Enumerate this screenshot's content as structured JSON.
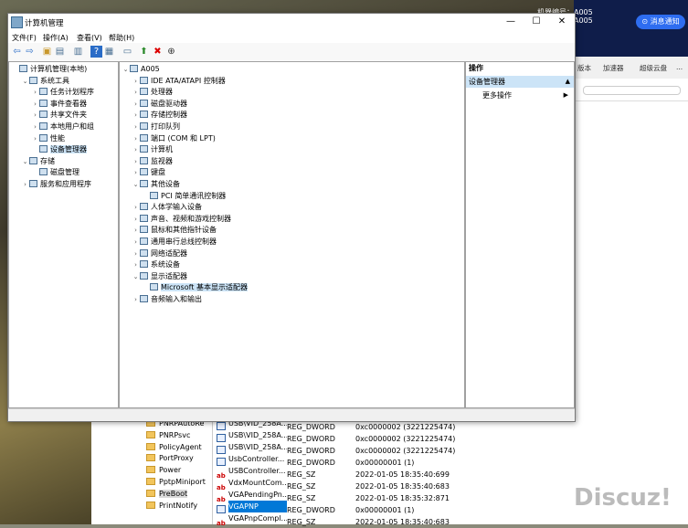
{
  "window": {
    "title": "计算机管理",
    "menu": [
      "文件(F)",
      "操作(A)",
      "查看(V)",
      "帮助(H)"
    ],
    "min": "—",
    "max": "☐",
    "close": "✕"
  },
  "left_tree": [
    {
      "label": "计算机管理(本地)",
      "arrow": "",
      "indent": 0,
      "sel": false
    },
    {
      "label": "系统工具",
      "arrow": "⌄",
      "indent": 1,
      "sel": false
    },
    {
      "label": "任务计划程序",
      "arrow": "›",
      "indent": 2,
      "sel": false
    },
    {
      "label": "事件查看器",
      "arrow": "›",
      "indent": 2,
      "sel": false
    },
    {
      "label": "共享文件夹",
      "arrow": "›",
      "indent": 2,
      "sel": false
    },
    {
      "label": "本地用户和组",
      "arrow": "›",
      "indent": 2,
      "sel": false
    },
    {
      "label": "性能",
      "arrow": "›",
      "indent": 2,
      "sel": false
    },
    {
      "label": "设备管理器",
      "arrow": "",
      "indent": 2,
      "sel": true
    },
    {
      "label": "存储",
      "arrow": "⌄",
      "indent": 1,
      "sel": false
    },
    {
      "label": "磁盘管理",
      "arrow": "",
      "indent": 2,
      "sel": false
    },
    {
      "label": "服务和应用程序",
      "arrow": "›",
      "indent": 1,
      "sel": false
    }
  ],
  "device_tree": [
    {
      "label": "A005",
      "arrow": "⌄",
      "indent": 0,
      "sel": false
    },
    {
      "label": "IDE ATA/ATAPI 控制器",
      "arrow": "›",
      "indent": 1,
      "sel": false
    },
    {
      "label": "处理器",
      "arrow": "›",
      "indent": 1,
      "sel": false
    },
    {
      "label": "磁盘驱动器",
      "arrow": "›",
      "indent": 1,
      "sel": false
    },
    {
      "label": "存储控制器",
      "arrow": "›",
      "indent": 1,
      "sel": false
    },
    {
      "label": "打印队列",
      "arrow": "›",
      "indent": 1,
      "sel": false
    },
    {
      "label": "端口 (COM 和 LPT)",
      "arrow": "›",
      "indent": 1,
      "sel": false
    },
    {
      "label": "计算机",
      "arrow": "›",
      "indent": 1,
      "sel": false
    },
    {
      "label": "监视器",
      "arrow": "›",
      "indent": 1,
      "sel": false
    },
    {
      "label": "键盘",
      "arrow": "›",
      "indent": 1,
      "sel": false
    },
    {
      "label": "其他设备",
      "arrow": "⌄",
      "indent": 1,
      "sel": false
    },
    {
      "label": "PCI 简单通讯控制器",
      "arrow": "",
      "indent": 2,
      "sel": false
    },
    {
      "label": "人体学输入设备",
      "arrow": "›",
      "indent": 1,
      "sel": false
    },
    {
      "label": "声音、视频和游戏控制器",
      "arrow": "›",
      "indent": 1,
      "sel": false
    },
    {
      "label": "鼠标和其他指针设备",
      "arrow": "›",
      "indent": 1,
      "sel": false
    },
    {
      "label": "通用串行总线控制器",
      "arrow": "›",
      "indent": 1,
      "sel": false
    },
    {
      "label": "网络适配器",
      "arrow": "›",
      "indent": 1,
      "sel": false
    },
    {
      "label": "系统设备",
      "arrow": "›",
      "indent": 1,
      "sel": false
    },
    {
      "label": "显示适配器",
      "arrow": "⌄",
      "indent": 1,
      "sel": false
    },
    {
      "label": "Microsoft 基本显示适配器",
      "arrow": "",
      "indent": 2,
      "sel": true
    },
    {
      "label": "音频输入和输出",
      "arrow": "›",
      "indent": 1,
      "sel": false
    }
  ],
  "actions": {
    "header": "操作",
    "selected": "设备管理器",
    "more": "更多操作"
  },
  "site": {
    "user_label": "机器编号：A005",
    "user_sub": "A005",
    "msg_button": "消息通知",
    "nav": [
      "版本",
      "加速器",
      "超级云盘",
      "..."
    ],
    "watermark": "Discuz!"
  },
  "registry": {
    "keys": [
      "PNRPAutoRe",
      "PNRPsvc",
      "PolicyAgent",
      "PortProxy",
      "Power",
      "PptpMiniport",
      "PreBoot",
      "PrintNotify"
    ],
    "selected_key": "PreBoot",
    "values": [
      {
        "name": "USB\\VID_258A...",
        "type": "REG_DWORD",
        "data": "0xc0000002 (3221225474)",
        "kind": "dword"
      },
      {
        "name": "USB\\VID_258A...",
        "type": "REG_DWORD",
        "data": "0xc0000002 (3221225474)",
        "kind": "dword"
      },
      {
        "name": "USB\\VID_258A...",
        "type": "REG_DWORD",
        "data": "0xc0000002 (3221225474)",
        "kind": "dword"
      },
      {
        "name": "UsbController...",
        "type": "REG_DWORD",
        "data": "0x00000001 (1)",
        "kind": "dword"
      },
      {
        "name": "USBController...",
        "type": "REG_SZ",
        "data": "2022-01-05 18:35:40:699",
        "kind": "sz"
      },
      {
        "name": "VdxMountCom...",
        "type": "REG_SZ",
        "data": "2022-01-05 18:35:40:683",
        "kind": "sz"
      },
      {
        "name": "VGAPendingPn...",
        "type": "REG_SZ",
        "data": "2022-01-05 18:35:32:871",
        "kind": "sz"
      },
      {
        "name": "VGAPNP",
        "type": "REG_DWORD",
        "data": "0x00000001 (1)",
        "kind": "dword",
        "sel": true
      },
      {
        "name": "VGAPnpCompl...",
        "type": "REG_SZ",
        "data": "2022-01-05 18:35:40:683",
        "kind": "sz"
      }
    ]
  }
}
